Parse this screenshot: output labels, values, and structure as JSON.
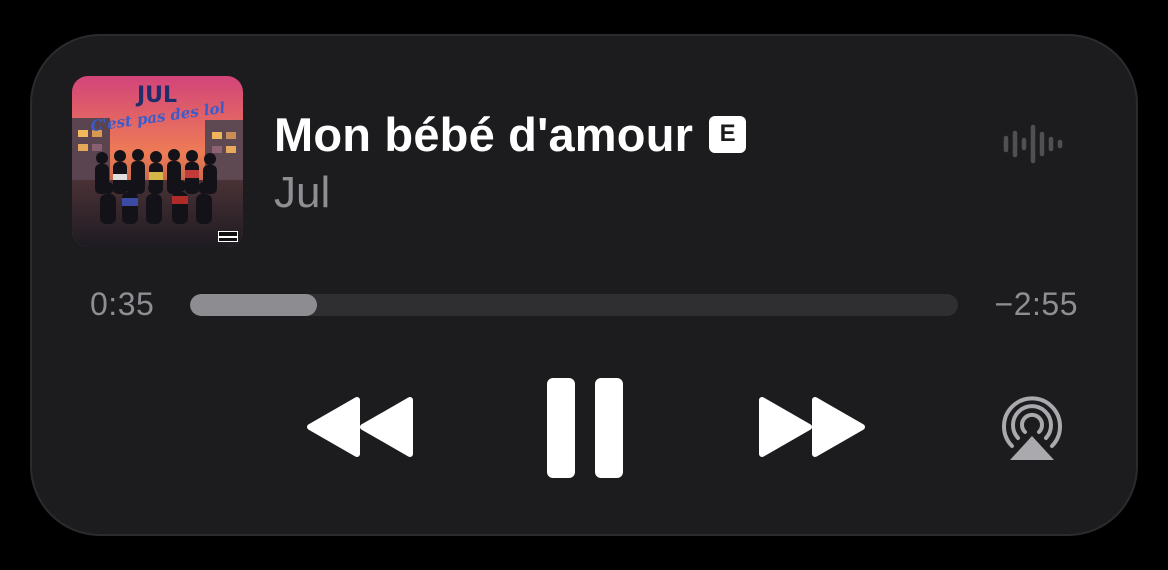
{
  "player": {
    "song_title": "Mon bébé d'amour",
    "explicit_badge": "E",
    "artist": "Jul",
    "time_elapsed": "0:35",
    "time_remaining": "−2:55",
    "progress_fraction": 0.166
  },
  "artwork": {
    "artist_text": "JUL",
    "album_text": "C'est pas des lol",
    "advisory_text": "PARENTAL ADVISORY"
  },
  "icons": {
    "activity": "waveform-icon",
    "rewind": "backward-icon",
    "pause": "pause-icon",
    "forward": "forward-icon",
    "airplay": "airplay-icon"
  },
  "colors": {
    "card_background": "#1c1c1e",
    "primary_text": "#ffffff",
    "secondary_text": "#8e8e93",
    "progress_track": "#2f2f32",
    "progress_fill": "#8c8c91"
  }
}
